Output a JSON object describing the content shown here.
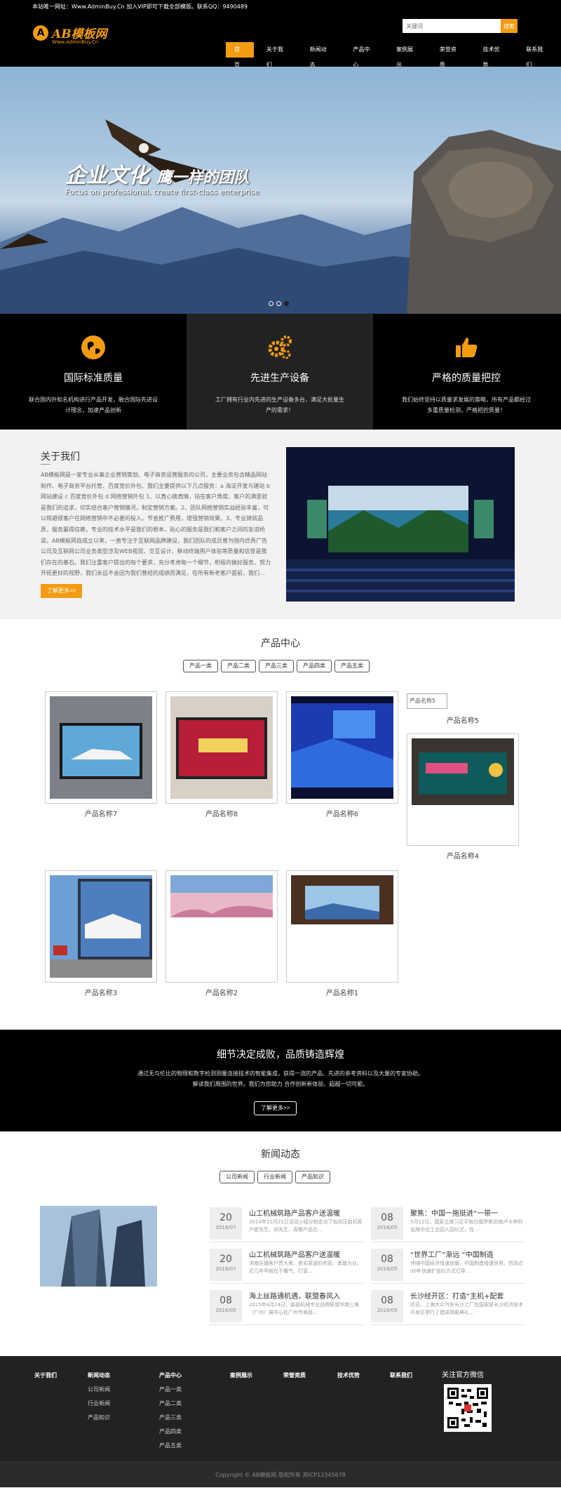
{
  "topbar": {
    "text": "本站唯一网址：Www.AdminBuy.Cn 加入VIP即可下载全部模版。联系QQ：9490489"
  },
  "logo": {
    "mark": "A",
    "text": "AB模板网",
    "subtitle": "Www.AdminBuy.Cn"
  },
  "search": {
    "placeholder": "关键词",
    "button": "搜索"
  },
  "nav": [
    "首页",
    "关于我们",
    "新闻动态",
    "产品中心",
    "案例展示",
    "荣誉资质",
    "技术优势",
    "联系我们"
  ],
  "hero": {
    "title": "企业文化",
    "title2": "鹰一样的团队",
    "subtitle": "Focus on professional, create first-class enterprise"
  },
  "features": [
    {
      "title": "国际标准质量",
      "text": "联合国内外知名机构进行产品开发，融合国际先进设计理念，加速产品创新",
      "icon": "globe-icon"
    },
    {
      "title": "先进生产设备",
      "text": "工厂拥有行业内先进的生产设备多台，满足大批量生产的需求！",
      "icon": "gears-icon"
    },
    {
      "title": "严格的质量把控",
      "text": "我们始终坚持以质量求发展的策略，所有产品都经过多重质量检测，严格把控质量！",
      "icon": "thumbs-up-icon"
    }
  ],
  "about": {
    "title": "关于我们",
    "text": "AB模板网是一家专业从事企业营销策划、电子商务运营服务的公司，主要业务包含精品网站制作、电子商务平台托管、百度竞价外包、我们主要提供以下几点服务：a 海淀开发与建站 b 网站建设 c 百度竞价外包 d 网络营销外包 1、以真心换真情，站在客户角度、客户的满意就是我们的追求，切实结合客户营销情况，制定营销方案。2、团队网络营销实战经验丰富，可以规避很客户在网络营销中不必要的投入。节省推广费用，增强营销效果。3、专业铸就品质，服务赢得信赖，专业的技术水平是我们的根本，贴心的服务是我们和客户之间的友谊桥梁。AB模板网自成立以来，一直专注于互联网品牌建设，我们团队的成员曾为国内优秀广告公司及互联网公司业务类型涉及WEB视觉、交互设计、移动终端用户体验等质量和信誉是我们存在的基石。我们注重客户提出的每个要求，充分考虑每一个细节，积极的做好服务，努力开拓更好的视野，我们永远不会因为我们曾经的成绩而满足，在所有新老客户面前，我们...",
    "more": "了解更多>>"
  },
  "products": {
    "title": "产品中心",
    "tabs": [
      "产品一类",
      "产品二类",
      "产品三类",
      "产品四类",
      "产品五类"
    ],
    "items": [
      "产品名称7",
      "产品名称8",
      "产品名称6",
      "产品名称4",
      "产品名称3",
      "产品名称2",
      "产品名称1"
    ],
    "broken_alt": "产品名称5",
    "broken_name": "产品名称5"
  },
  "banner": {
    "title": "细节决定成败，品质铸造辉煌",
    "line1": "通过无与伦比的物理和数字检测测量连接技术的智能集成，获得一流的产品、先进的参考资料以及大量的专家协助。",
    "line2": "解读我们周围的世界。我们为您助力 合作创新新体验、超越一切可能。",
    "button": "了解更多>>"
  },
  "news": {
    "title": "新闻动态",
    "tabs": [
      "公司新闻",
      "行业新闻",
      "产品知识"
    ],
    "items": [
      {
        "day": "20",
        "ym": "2018/07",
        "title": "山工机械筑路产品客户送温暖",
        "summary": "2014年11月21日活动小组分别走访了包司压路机客户崔先生、邱先生、周都产品巨..."
      },
      {
        "day": "08",
        "ym": "2016/05",
        "title": "聚焦：中国一拖挺进“一带一",
        "summary": "5月12日。国家主席习近平和白俄罗斯总统卢卡申科出席中白工业园入园仪式，在..."
      },
      {
        "day": "20",
        "ym": "2018/07",
        "title": "山工机械筑路产品客户送温暖",
        "summary": "济南压铺客户贾大荣、老实厚道的农民、勇敢为业、近几年早就在不懈气、打营..."
      },
      {
        "day": "08",
        "ym": "2016/05",
        "title": "“世界工厂”渐远 “中国制造",
        "summary": "伴随中国经济增速放缓、中国制造增速世界。然而近30年快速扩张的方式已导..."
      },
      {
        "day": "08",
        "ym": "2016/05",
        "title": "海上丝路通机遇，联盟春风入",
        "summary": "2015年4月24日，路面机械专业品牌联盟华南三角（广州）展中心在广州市奥路..."
      },
      {
        "day": "08",
        "ym": "2016/05",
        "title": "长沙经开区：打造“主机+配套",
        "summary": "近日，上海大众汽车长沙工厂在国家级长沙经济技术开发区举行了建成揭幕典礼..."
      }
    ]
  },
  "footer": {
    "columns": [
      {
        "head": "关于我们",
        "links": []
      },
      {
        "head": "新闻动态",
        "links": [
          "公司新闻",
          "行业新闻",
          "产品知识"
        ]
      },
      {
        "head": "产品中心",
        "links": [
          "产品一类",
          "产品二类",
          "产品三类",
          "产品四类",
          "产品五类"
        ]
      },
      {
        "head": "案例展示",
        "links": []
      },
      {
        "head": "荣誉资质",
        "links": []
      },
      {
        "head": "技术优势",
        "links": []
      },
      {
        "head": "联系我们",
        "links": []
      }
    ],
    "follow": "关注官方微信",
    "copyright": "Copyright © AB模板网 版权所有   苏ICP12345678"
  },
  "colors": {
    "accent": "#f39c12",
    "dark": "#000000",
    "footer": "#222222"
  }
}
